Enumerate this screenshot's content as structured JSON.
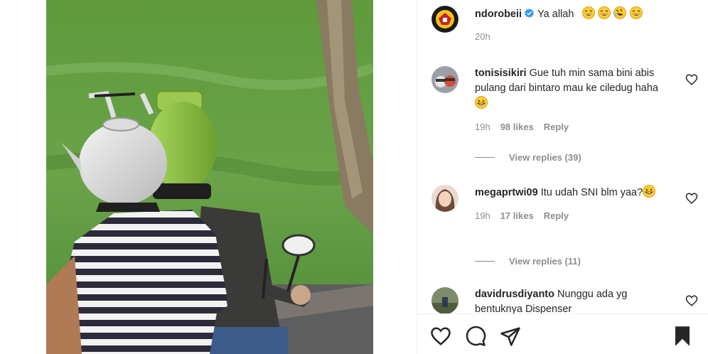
{
  "post": {
    "caption": {
      "username": "ndorobeii",
      "text": "Ya allah",
      "emojis": [
        "laughing-emoji",
        "laughing-emoji",
        "rofl-emoji",
        "laughing-emoji"
      ],
      "time": "20h"
    },
    "comments": [
      {
        "username": "tonisisikiri",
        "text": "Gue tuh min sama bini abis pulang dari bintaro mau ke ciledug haha",
        "emoji": "grinning-emoji",
        "time": "19h",
        "likes": "98 likes",
        "reply_label": "Reply",
        "view_replies": "View replies (39)"
      },
      {
        "username": "megaprtwi09",
        "text": "Itu udah SNI blm yaa?",
        "emoji": "grinning-emoji",
        "time": "19h",
        "likes": "17 likes",
        "reply_label": "Reply",
        "view_replies": "View replies (11)"
      },
      {
        "username": "davidrusdiyanto",
        "text": "Nunggu ada yg bentuknya Dispenser",
        "emoji": "",
        "time": "",
        "likes": "",
        "reply_label": "",
        "view_replies": ""
      }
    ],
    "actions": [
      "like-icon",
      "comment-icon",
      "share-icon",
      "save-icon"
    ]
  },
  "colors": {
    "verified": "#3897f0",
    "muted": "#8e8e8e",
    "text": "#262626",
    "kettle_helmet": "#e8e8e8",
    "gas_helmet": "#8dc63f"
  }
}
